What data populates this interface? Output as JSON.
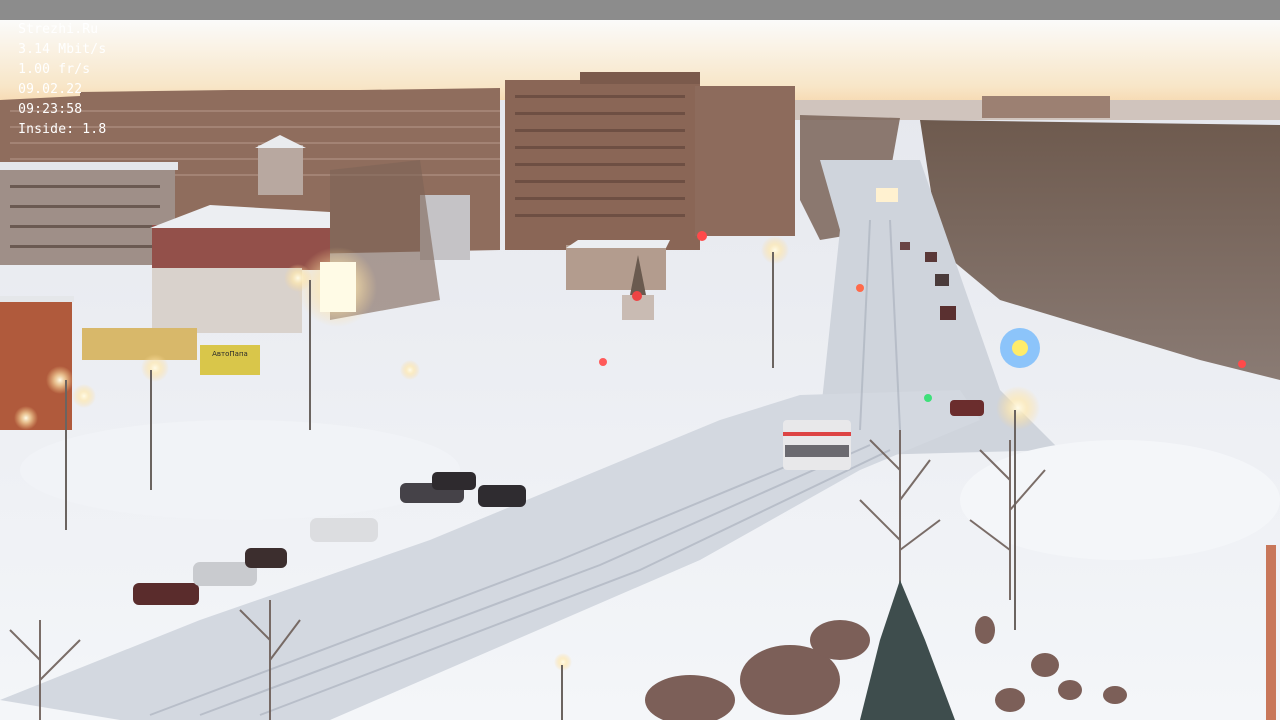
{
  "overlay": {
    "site": "Strezhi.Ru",
    "bitrate": "3.14 Mbit/s",
    "framerate": "1.00 fr/s",
    "date": "09.02.22",
    "time": "09:23:58",
    "inside": "Inside: 1.8"
  },
  "signs": {
    "shop": "АвтоПапа"
  },
  "colors": {
    "sky_top": "#f8f8f6",
    "sky_horizon": "#f6cf9a",
    "buildings": "#8a6a5a",
    "snow": "#eef1f4",
    "road": "#d7dbe2",
    "trees": "#6a5648",
    "streetlight": "#fff3c8"
  }
}
